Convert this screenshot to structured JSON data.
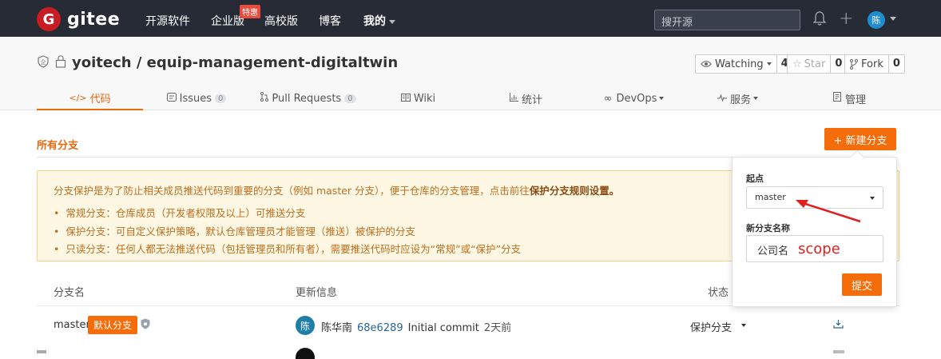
{
  "topnav": {
    "logo_text": "gitee",
    "items": [
      "开源软件",
      "企业版",
      "高校版",
      "博客",
      "我的"
    ],
    "badge": "特惠",
    "search_placeholder": "搜开源",
    "avatar": "陈"
  },
  "repo": {
    "name": "yoitech / equip-management-digitaltwin",
    "watching_label": "Watching",
    "watching_count": "4",
    "star_label": "Star",
    "star_count": "0",
    "fork_label": "Fork",
    "fork_count": "0"
  },
  "tabs": [
    {
      "label": "代码",
      "active": true
    },
    {
      "label": "Issues",
      "badge": "0"
    },
    {
      "label": "Pull Requests",
      "badge": "0"
    },
    {
      "label": "Wiki"
    },
    {
      "label": "统计"
    },
    {
      "label": "DevOps"
    },
    {
      "label": "服务"
    },
    {
      "label": "管理"
    }
  ],
  "section": {
    "title": "所有分支",
    "new_branch_label": "+ 新建分支"
  },
  "notice": {
    "lead": "分支保护是为了防止相关成员推送代码到重要的分支（例如 master 分支），便于仓库的分支管理，点击前往",
    "lead_link": "保护分支规则设置。",
    "items": [
      "常规分支：仓库成员（开发者权限及以上）可推送分支",
      "保护分支：可自定义保护策略，默认仓库管理员才能管理（推送）被保护的分支",
      "只读分支：任何人都无法推送代码（包括管理员和所有者），需要推送代码时应设为“常规”或“保护”分支"
    ]
  },
  "table": {
    "headers": {
      "branch": "分支名",
      "update": "更新信息",
      "status": "状态"
    },
    "rows": [
      {
        "branch": "master",
        "default_badge": "默认分支",
        "avatar": "陈",
        "author": "陈华南",
        "sha": "68e6289",
        "message": "Initial commit",
        "time": "2天前",
        "status": "保护分支"
      }
    ]
  },
  "panel": {
    "start_label": "起点",
    "start_value": "master",
    "name_label": "新分支名称",
    "name_value": "公司名",
    "annotation": "scope",
    "submit_label": "提交"
  },
  "colors": {
    "accent": "#f56c0a",
    "nav_bg": "#262b36",
    "annotation": "#e02020"
  }
}
